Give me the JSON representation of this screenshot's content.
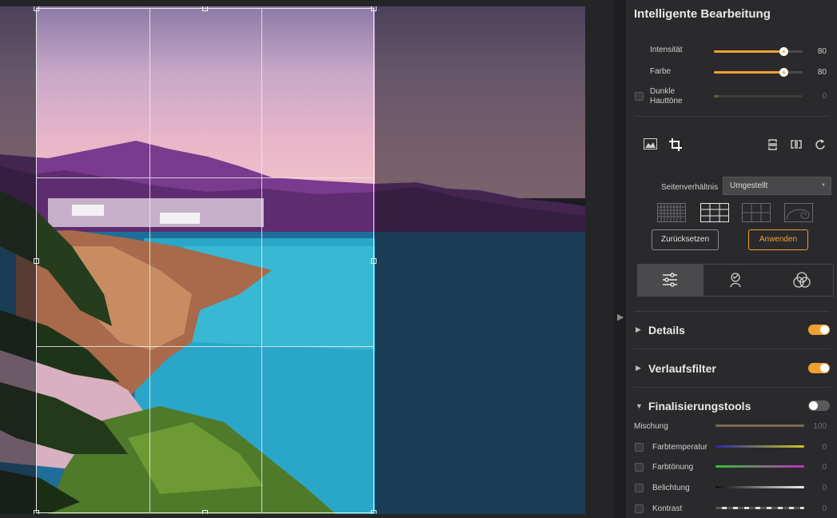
{
  "panel": {
    "title": "Intelligente Bearbeitung",
    "sliders": [
      {
        "label": "Intensität",
        "value": "80",
        "level": 0.8
      },
      {
        "label": "Farbe",
        "value": "80",
        "level": 0.8
      },
      {
        "label": "Dunkle Hauttöne",
        "value": "0",
        "level": 0
      }
    ],
    "crop": {
      "ratio_label": "Seitenverhältnis",
      "ratio_value": "Umgestellt",
      "reset_label": "Zurücksetzen",
      "apply_label": "Anwenden"
    },
    "sections": [
      {
        "title": "Details",
        "enabled": true
      },
      {
        "title": "Verlaufsfilter",
        "enabled": true
      },
      {
        "title": "Finalisierungstools",
        "enabled": false
      }
    ],
    "finalize": {
      "mix_label": "Mischung",
      "mix_value": "100",
      "items": [
        {
          "label": "Farbtemperatur",
          "value": "0"
        },
        {
          "label": "Farbtönung",
          "value": "0"
        },
        {
          "label": "Belichtung",
          "value": "0"
        },
        {
          "label": "Kontrast",
          "value": "0"
        }
      ]
    }
  },
  "colors": {
    "accent": "#f0a030",
    "panel_bg": "#2a2a2d",
    "toggle_off": "#5a5a5c"
  }
}
